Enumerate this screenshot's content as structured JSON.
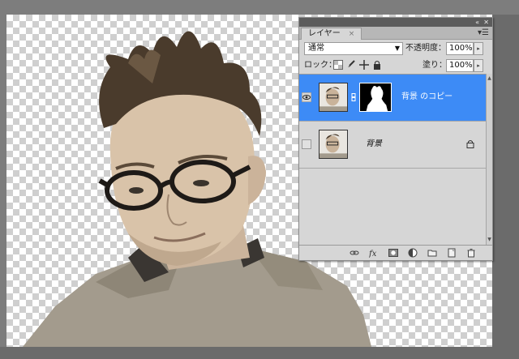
{
  "panel": {
    "tab_label": "レイヤー",
    "tab_close": "×",
    "collapse_glyph": "«",
    "close_glyph": "✕",
    "menu_glyph": "▾☰",
    "blend_mode": "通常",
    "opacity_label": "不透明度：",
    "opacity_value": "100%",
    "lock_label": "ロック：",
    "fill_label": "塗り：",
    "fill_value": "100%"
  },
  "layers": [
    {
      "name": "背景 のコピー",
      "visible": true,
      "selected": true,
      "has_mask": true
    },
    {
      "name": "背景",
      "visible": false,
      "selected": false,
      "locked": true
    }
  ],
  "bottom_icons": [
    "link-layers-icon",
    "fx-icon",
    "add-mask-icon",
    "adjustment-layer-icon",
    "new-group-icon",
    "new-layer-icon",
    "trash-icon"
  ],
  "colors": {
    "selection": "#3d8bf6",
    "panel_bg": "#d6d6d6",
    "workspace": "#7d7d7d"
  }
}
